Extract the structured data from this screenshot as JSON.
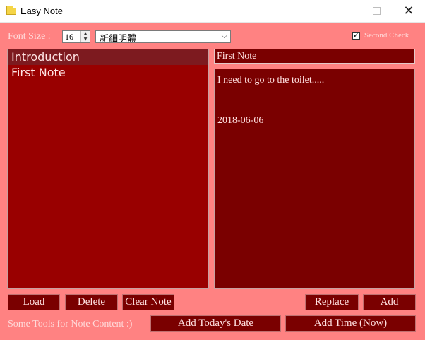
{
  "window": {
    "title": "Easy Note",
    "minimize_icon": "minimize-icon",
    "maximize_icon": "maximize-icon",
    "close_icon": "close-icon"
  },
  "toolbar": {
    "font_size_label": "Font Size :",
    "font_size_value": "16",
    "font_family_value": "新細明體",
    "second_check_label": "Second Check",
    "second_check_checked": true
  },
  "notes": {
    "items": [
      {
        "label": "Introduction",
        "selected": true
      },
      {
        "label": "First Note",
        "selected": false
      }
    ]
  },
  "editor": {
    "title_value": "First Note",
    "content_value": "I need to go to the toilet.....\n\n\n2018-06-06"
  },
  "buttons": {
    "load": "Load",
    "delete": "Delete",
    "clear_note": "Clear Note",
    "replace": "Replace",
    "add": "Add",
    "add_today_date": "Add Today's Date",
    "add_time_now": "Add Time (Now)"
  },
  "tools": {
    "label": "Some Tools for Note Content :)"
  },
  "colors": {
    "background": "#ff8282",
    "panel": "#990000",
    "panel_dark": "#7a0000",
    "selected_item": "#7d1a1f"
  }
}
